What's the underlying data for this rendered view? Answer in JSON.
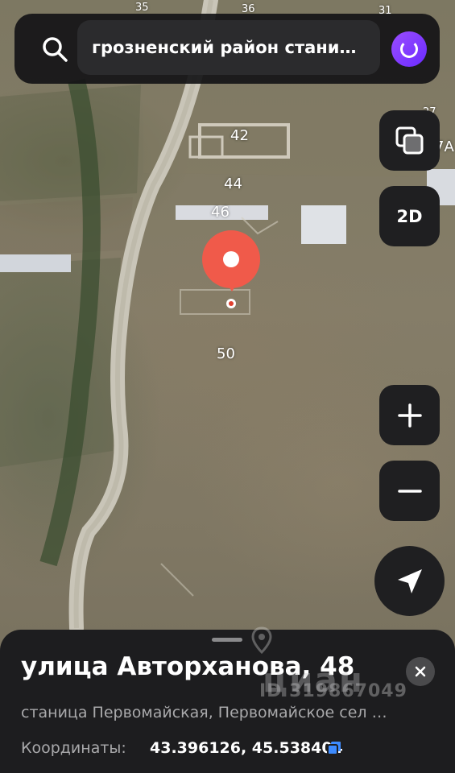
{
  "search": {
    "query": "грозненский район стани…"
  },
  "map": {
    "labels": {
      "n35": "35",
      "n36": "36",
      "n31": "31",
      "n27": "27",
      "n7a": "7А",
      "n42": "42",
      "n44": "44",
      "n46": "46",
      "n50": "50"
    }
  },
  "controls": {
    "layers_icon": "layers-icon",
    "mode_label": "2D",
    "zoom_in": "+",
    "zoom_out": "−",
    "locate_icon": "locate-arrow-icon"
  },
  "sheet": {
    "title": "улица Авторханова, 48",
    "subtitle": "станица Первомайская, Первомайское сел …",
    "coords_label": "Координаты:",
    "coords_value": "43.396126, 45.538404"
  },
  "watermark": {
    "text": "циан",
    "id": "ID 319867049"
  },
  "colors": {
    "pin": "#f05a4a",
    "accent": "#6b2bff",
    "panel": "#1f1f21"
  }
}
